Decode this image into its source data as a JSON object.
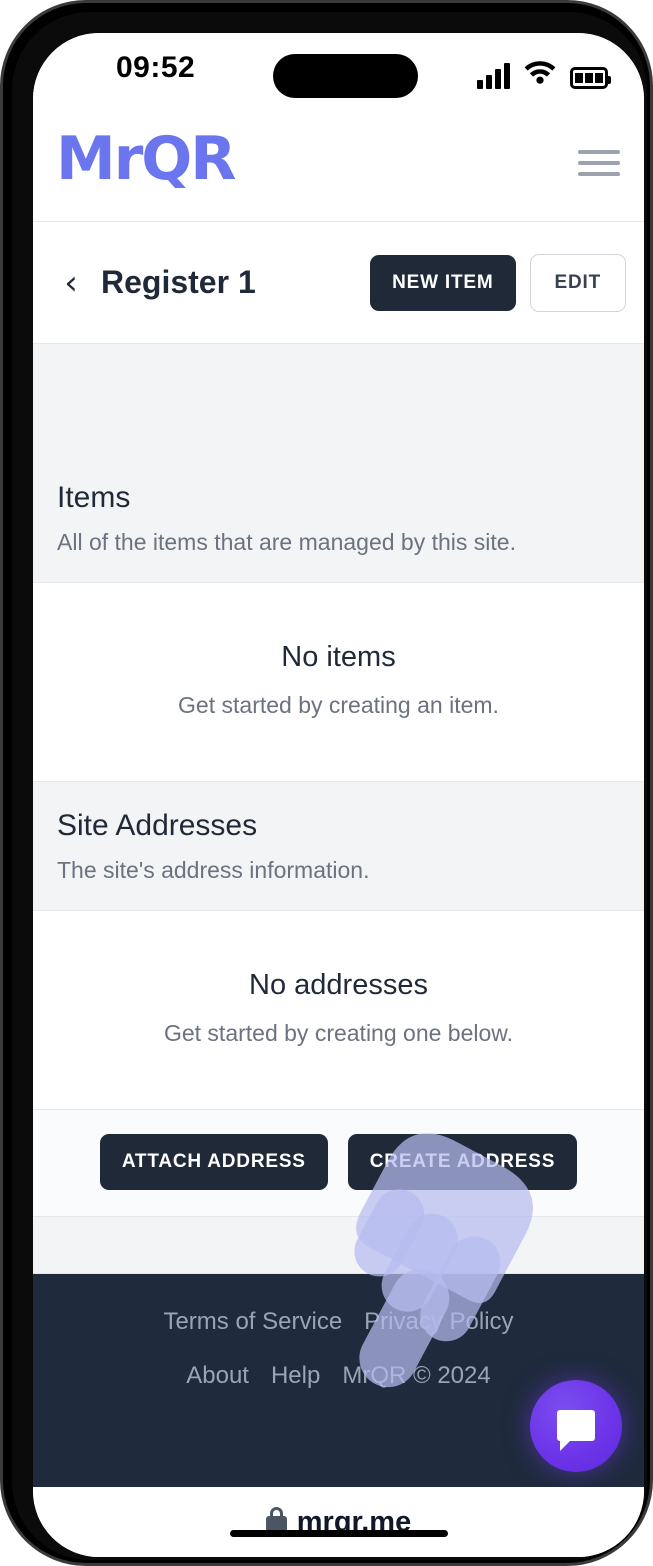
{
  "status_bar": {
    "time": "09:52",
    "icons": [
      "cellular-signal-icon",
      "wifi-icon",
      "battery-icon"
    ]
  },
  "brand": {
    "logo_text": "MrQR",
    "logo_color": "#6b76ee",
    "menu_icon": "hamburger-menu-icon"
  },
  "sub_header": {
    "back_icon": "chevron-left-icon",
    "title": "Register 1",
    "new_item_label": "NEW ITEM",
    "edit_label": "EDIT"
  },
  "items_section": {
    "title": "Items",
    "subtitle": "All of the items that are managed by this site.",
    "empty_title": "No items",
    "empty_subtitle": "Get started by creating an item."
  },
  "addresses_section": {
    "title": "Site Addresses",
    "subtitle": "The site's address information.",
    "empty_title": "No addresses",
    "empty_subtitle": "Get started by creating one below.",
    "attach_label": "ATTACH ADDRESS",
    "create_label": "CREATE ADDRESS"
  },
  "footer": {
    "terms_label": "Terms of Service",
    "privacy_label": "Privacy Policy",
    "about_label": "About",
    "help_label": "Help",
    "copyright": "MrQR © 2024",
    "chat_icon": "chat-bubble-icon",
    "background_color": "#1f2a3c"
  },
  "browser_bar": {
    "lock_icon": "lock-icon",
    "url": "mrqr.me"
  },
  "cursor": {
    "icon": "pointing-hand-cursor",
    "color": "#b6bbee"
  }
}
